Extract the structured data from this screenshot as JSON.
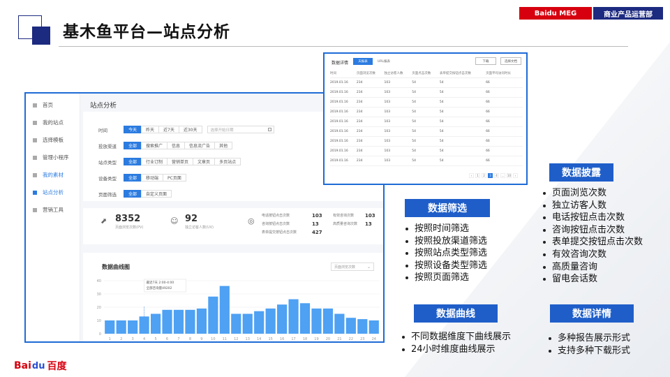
{
  "header": {
    "tag_company": "Baidu MEG",
    "tag_dept": "商业产品运营部",
    "title": "基木鱼平台—站点分析"
  },
  "brand": {
    "logo_part1": "Bai",
    "logo_paw": "du",
    "logo_part2": "百度"
  },
  "app": {
    "sidebar": [
      {
        "label": "首页"
      },
      {
        "label": "我的站点"
      },
      {
        "label": "选择模板"
      },
      {
        "label": "管理小程序"
      },
      {
        "label": "我的素材"
      },
      {
        "label": "站点分析"
      },
      {
        "label": "营销工具"
      }
    ],
    "page_title": "站点分析",
    "filters": {
      "time": {
        "label": "时间",
        "options": [
          "今天",
          "昨天",
          "近7天",
          "近30天"
        ],
        "date_placeholder": "选择开始日期"
      },
      "channel": {
        "label": "投放渠道",
        "options": [
          "全部",
          "搜索推广",
          "信息",
          "信息流广告",
          "其他"
        ]
      },
      "site_type": {
        "label": "站点类型",
        "options": [
          "全部",
          "行业订制",
          "营销单页",
          "文章页",
          "多页站点"
        ]
      },
      "device": {
        "label": "设备类型",
        "options": [
          "全部",
          "移动端",
          "PC页面"
        ]
      },
      "page": {
        "label": "页面筛选",
        "options": [
          "全部",
          "自定义页面"
        ]
      }
    },
    "stats": {
      "pv": {
        "value": "8352",
        "label": "页面浏览次数(PV)"
      },
      "uv": {
        "value": "92",
        "label": "独立访客人数(UV)"
      },
      "mini": [
        {
          "label": "电话按钮点击次数",
          "value": "103"
        },
        {
          "label": "咨询按钮点击次数",
          "value": "13"
        },
        {
          "label": "表单提交按钮点击次数",
          "value": "427"
        },
        {
          "label": "有效咨询次数",
          "value": "103"
        },
        {
          "label": "高质量咨询次数",
          "value": "13"
        }
      ]
    },
    "chart_title": "数据曲线图",
    "chart_select": "页面浏览次数",
    "tooltip": {
      "line1": "最近7天 2:00-4:00",
      "line2": "全部咨询量49202"
    }
  },
  "chart_data": {
    "type": "bar",
    "categories": [
      "1",
      "2",
      "3",
      "4",
      "5",
      "6",
      "7",
      "8",
      "9",
      "10",
      "11",
      "12",
      "13",
      "14",
      "15",
      "16",
      "17",
      "18",
      "19",
      "20",
      "21",
      "22",
      "23",
      "24"
    ],
    "values": [
      10,
      10,
      10,
      13,
      15,
      18,
      18,
      18,
      19,
      28,
      36,
      15,
      15,
      17,
      19,
      22,
      26,
      23,
      19,
      19,
      15,
      12,
      11,
      10
    ],
    "yticks": [
      0,
      10,
      20,
      30,
      40
    ],
    "ylim": [
      0,
      40
    ],
    "xlabel": "",
    "ylabel": "",
    "title": "数据曲线图"
  },
  "detail": {
    "title": "数据详情",
    "tabs": [
      "天报表",
      "URL报表"
    ],
    "buttons": [
      "下载",
      "选择文档"
    ],
    "columns": [
      "时间",
      "页面浏览次数",
      "独立访客人数",
      "页面点击次数",
      "表单提交按钮点击次数",
      "页面平均访问时长"
    ],
    "rows": [
      [
        "2019.01.16",
        "234",
        "103",
        "54",
        "54",
        "66"
      ],
      [
        "2019.01.16",
        "234",
        "103",
        "54",
        "54",
        "66"
      ],
      [
        "2019.01.16",
        "234",
        "103",
        "54",
        "54",
        "66"
      ],
      [
        "2019.01.16",
        "234",
        "103",
        "54",
        "54",
        "66"
      ],
      [
        "2019.01.16",
        "234",
        "103",
        "54",
        "54",
        "66"
      ],
      [
        "2019.01.16",
        "234",
        "103",
        "54",
        "54",
        "66"
      ],
      [
        "2019.01.16",
        "234",
        "103",
        "54",
        "54",
        "66"
      ],
      [
        "2019.01.16",
        "234",
        "103",
        "54",
        "54",
        "66"
      ],
      [
        "2019.01.16",
        "234",
        "103",
        "54",
        "54",
        "66"
      ]
    ],
    "pager": [
      "‹",
      "1",
      "2",
      "3",
      "4",
      "…",
      "10",
      "›"
    ]
  },
  "features": {
    "disclosure": {
      "title": "数据披露",
      "items": [
        "页面浏览次数",
        "独立访客人数",
        "电话按钮点击次数",
        "咨询按钮点击次数",
        "表单提交按钮点击次数",
        "有效咨询次数",
        "高质量咨询",
        "留电会话数"
      ]
    },
    "filter": {
      "title": "数据筛选",
      "items": [
        "按照时间筛选",
        "按照投放渠道筛选",
        "按照站点类型筛选",
        "按照设备类型筛选",
        "按照页面筛选"
      ]
    },
    "curve": {
      "title": "数据曲线",
      "items": [
        "不同数据维度下曲线展示",
        "24小时维度曲线展示"
      ]
    },
    "detail": {
      "title": "数据详情",
      "items": [
        "多种报告展示形式",
        "支持多种下载形式"
      ]
    }
  }
}
